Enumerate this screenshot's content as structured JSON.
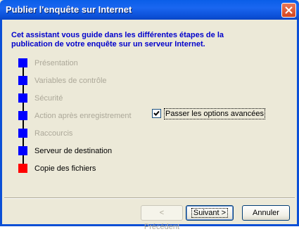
{
  "window": {
    "title": "Publier l'enquête sur Internet"
  },
  "header": {
    "line1": "Cet assistant vous guide dans les différentes étapes de la",
    "line2": "publication de votre enquête sur un serveur Internet."
  },
  "steps": [
    {
      "label": "Présentation",
      "state": "disabled",
      "color": "#0000ff"
    },
    {
      "label": "Variables de contrôle",
      "state": "disabled",
      "color": "#0000ff"
    },
    {
      "label": "Sécurité",
      "state": "disabled",
      "color": "#0000ff"
    },
    {
      "label": "Action après enregistrement",
      "state": "disabled",
      "color": "#0000ff"
    },
    {
      "label": "Raccourcis",
      "state": "disabled",
      "color": "#0000ff"
    },
    {
      "label": "Serveur de destination",
      "state": "normal",
      "color": "#0000ff"
    },
    {
      "label": "Copie des fichiers",
      "state": "current",
      "color": "#ff0000"
    }
  ],
  "options": {
    "advanced_label": "Passer les options avancées",
    "advanced_checked": true
  },
  "buttons": {
    "previous": "< Précédent",
    "next": "Suivant >",
    "cancel": "Annuler"
  },
  "colors": {
    "title_bar": "#0b4fd6",
    "header_text": "#0000cc",
    "step_done": "#0000ff",
    "step_current": "#ff0000"
  }
}
